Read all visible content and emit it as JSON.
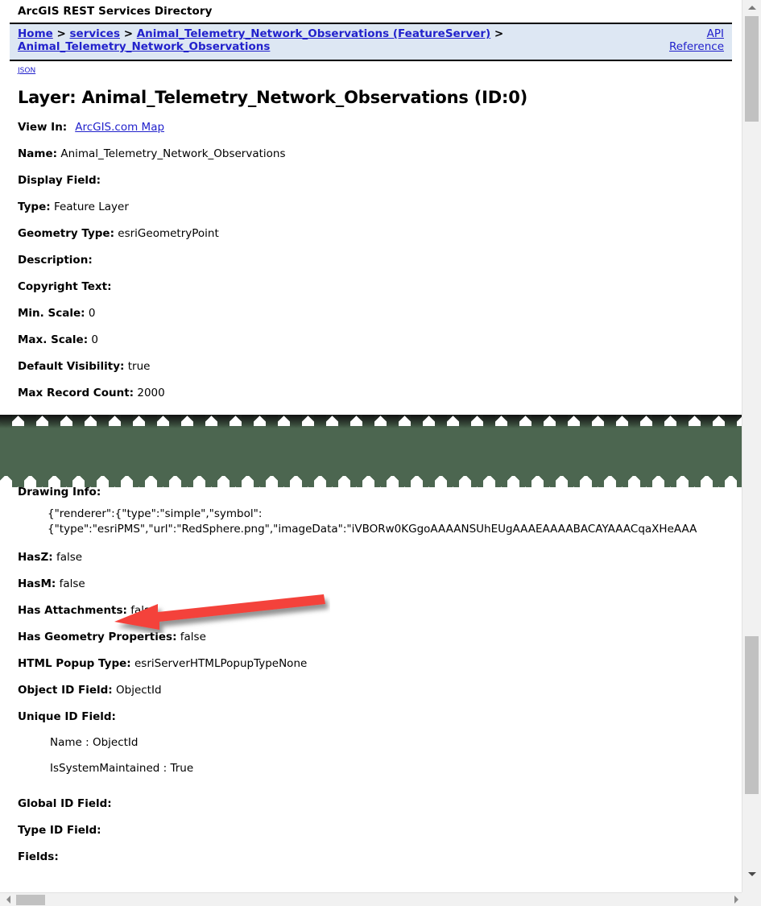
{
  "app": {
    "title": "ArcGIS REST Services Directory"
  },
  "breadcrumb": {
    "items": [
      {
        "label": "Home",
        "type": "link"
      },
      {
        "label": ">",
        "type": "sep"
      },
      {
        "label": "services",
        "type": "link"
      },
      {
        "label": ">",
        "type": "sep"
      },
      {
        "label": "Animal_Telemetry_Network_Observations (FeatureServer)",
        "type": "link"
      },
      {
        "label": ">",
        "type": "sep"
      },
      {
        "label": "Animal_Telemetry_Network_Observations",
        "type": "link"
      }
    ],
    "api_reference_line1": "API",
    "api_reference_line2": "Reference",
    "background_color": "#dde7f3"
  },
  "json_link": {
    "label": "JSON"
  },
  "page": {
    "heading": "Layer: Animal_Telemetry_Network_Observations (ID:0)",
    "view_in_label": "View In:",
    "view_in_link": "ArcGIS.com Map"
  },
  "properties": [
    {
      "key": "Name:",
      "value": "Animal_Telemetry_Network_Observations"
    },
    {
      "key": "Display Field:",
      "value": ""
    },
    {
      "key": "Type:",
      "value": "Feature Layer"
    },
    {
      "key": "Geometry Type:",
      "value": "esriGeometryPoint"
    },
    {
      "key": "Description:",
      "value": ""
    },
    {
      "key": "Copyright Text:",
      "value": ""
    },
    {
      "key": "Min. Scale:",
      "value": "0"
    },
    {
      "key": "Max. Scale:",
      "value": "0"
    },
    {
      "key": "Default Visibility:",
      "value": "true"
    },
    {
      "key": "Max Record Count:",
      "value": "2000"
    }
  ],
  "drawing_info": {
    "key": "Drawing Info:",
    "line1": "{\"renderer\":{\"type\":\"simple\",\"symbol\":",
    "line2": "{\"type\":\"esriPMS\",\"url\":\"RedSphere.png\",\"imageData\":\"iVBORw0KGgoAAAANSUhEUgAAAEAAAABACAYAAACqaXHeAAA"
  },
  "properties_lower": [
    {
      "key": "HasZ:",
      "value": "false"
    },
    {
      "key": "HasM:",
      "value": "false"
    },
    {
      "key": "Has Attachments:",
      "value": "false"
    },
    {
      "key": "Has Geometry Properties:",
      "value": "false"
    },
    {
      "key": "HTML Popup Type:",
      "value": "esriServerHTMLPopupTypeNone"
    },
    {
      "key": "Object ID Field:",
      "value": "ObjectId"
    },
    {
      "key": "Unique ID Field:",
      "value": ""
    }
  ],
  "unique_id_field_details": [
    "Name : ObjectId",
    "IsSystemMaintained : True"
  ],
  "properties_tail": [
    {
      "key": "Global ID Field:",
      "value": ""
    },
    {
      "key": "Type ID Field:",
      "value": ""
    },
    {
      "key": "Fields:",
      "value": ""
    }
  ],
  "annotation": {
    "arrow_color": "#f4433b",
    "arrow_shadow_color": "#9a9a9a",
    "direction": "left",
    "points_at": "HasM: false"
  },
  "torn_band": {
    "fill_color": "#4c6650",
    "cap_color": "#0f0f0f"
  },
  "scrollbars": {
    "vertical_up_icon": "triangle-up-icon",
    "vertical_down_icon": "triangle-down-icon",
    "horizontal_left_icon": "triangle-left-icon",
    "horizontal_right_icon": "triangle-right-icon",
    "track_color": "#f1f1f1",
    "thumb_color": "#c1c1c1"
  }
}
